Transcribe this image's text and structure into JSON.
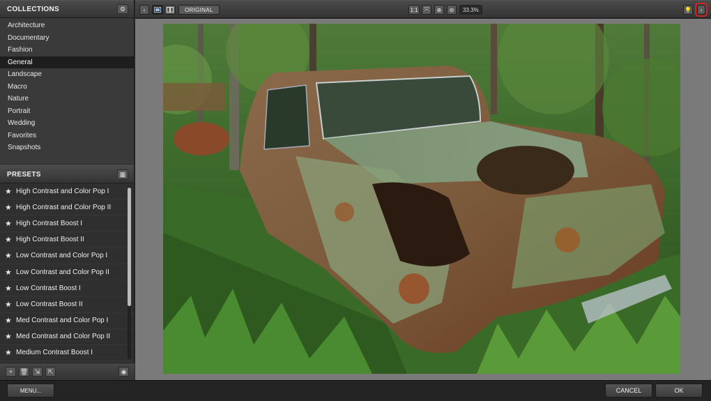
{
  "collections": {
    "title": "COLLECTIONS",
    "items": [
      "Architecture",
      "Documentary",
      "Fashion",
      "General",
      "Landscape",
      "Macro",
      "Nature",
      "Portrait",
      "Wedding",
      "Favorites",
      "Snapshots"
    ],
    "active": "General"
  },
  "presets": {
    "title": "PRESETS",
    "items": [
      "High Contrast and Color Pop I",
      "High Contrast and Color Pop II",
      "High Contrast Boost I",
      "High Contrast Boost II",
      "Low Contrast and Color Pop I",
      "Low Contrast and Color Pop II",
      "Low Contrast Boost I",
      "Low Contrast Boost II",
      "Med Contrast and Color Pop I",
      "Med Contrast and Color Pop II",
      "Medium Contrast Boost I"
    ],
    "scroll_position": 0.0
  },
  "toolbar": {
    "original_label": "ORIGINAL",
    "one_to_one_label": "1:1",
    "zoom_value": "33.3%"
  },
  "bottom": {
    "menu_label": "MENU...",
    "cancel_label": "CANCEL",
    "ok_label": "OK"
  },
  "icons": {
    "collapse_left": "chevron-left-icon",
    "single_view": "single-view-icon",
    "split_view": "split-view-icon",
    "fit": "fit-screen-icon",
    "zoom_in": "zoom-in-icon",
    "zoom_out": "zoom-out-icon",
    "lightbulb": "lightbulb-icon",
    "collapse_right": "chevron-right-panel-icon"
  },
  "colors": {
    "highlight_outline": "#d42020",
    "active_collection_bg": "#1e1e1e"
  }
}
